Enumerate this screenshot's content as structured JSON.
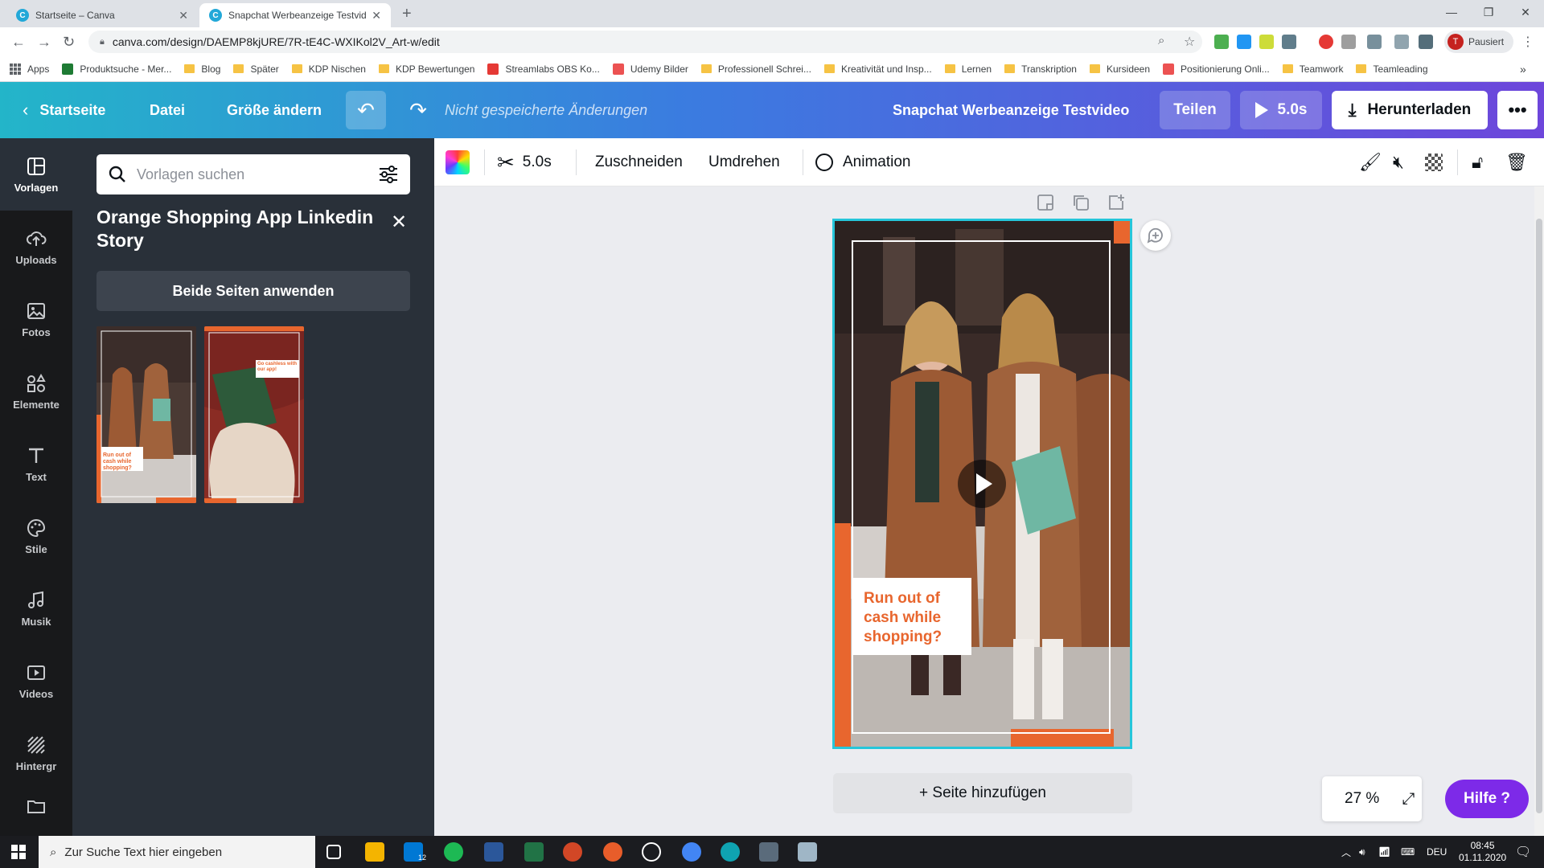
{
  "browser": {
    "tabs": [
      {
        "title": "Startseite – Canva",
        "active": false
      },
      {
        "title": "Snapchat Werbeanzeige Testvide",
        "active": true
      }
    ],
    "url": "canva.com/design/DAEMP8kjURE/7R-tE4C-WXIKol2V_Art-w/edit",
    "profile_label": "Pausiert",
    "profile_initial": "T",
    "bookmarks": [
      "Apps",
      "Produktsuche - Mer...",
      "Blog",
      "Später",
      "KDP Nischen",
      "KDP Bewertungen",
      "Streamlabs OBS Ko...",
      "Udemy Bilder",
      "Professionell Schrei...",
      "Kreativität und Insp...",
      "Lernen",
      "Transkription",
      "Kursideen",
      "Positionierung Onli...",
      "Teamwork",
      "Teamleading"
    ]
  },
  "header": {
    "home": "Startseite",
    "file": "Datei",
    "resize": "Größe ändern",
    "unsaved": "Nicht gespeicherte Änderungen",
    "design_title": "Snapchat Werbeanzeige Testvideo",
    "share": "Teilen",
    "play": "5.0s",
    "download": "Herunterladen",
    "more": "•••"
  },
  "rail": [
    "Vorlagen",
    "Uploads",
    "Fotos",
    "Elemente",
    "Text",
    "Stile",
    "Musik",
    "Videos",
    "Hintergr"
  ],
  "panel": {
    "search_placeholder": "Vorlagen suchen",
    "title": "Orange Shopping App Linkedin Story",
    "apply_button": "Beide Seiten anwenden",
    "thumb1_caption": "Run out of cash while shopping?",
    "thumb2_caption": "Go cashless with our app!"
  },
  "toolbar": {
    "duration": "5.0s",
    "crop": "Zuschneiden",
    "flip": "Umdrehen",
    "animation": "Animation"
  },
  "canvas": {
    "caption": "Run out of cash while shopping?",
    "add_page": "+ Seite hinzufügen",
    "zoom": "27 %",
    "help": "Hilfe ?"
  },
  "taskbar": {
    "search_placeholder": "Zur Suche Text hier eingeben",
    "mail_badge": "12",
    "language": "DEU",
    "time": "08:45",
    "date": "01.11.2020"
  },
  "colors": {
    "accent_orange": "#e8662e",
    "canva_purple": "#7d2ae8",
    "selection_cyan": "#26c6da"
  }
}
